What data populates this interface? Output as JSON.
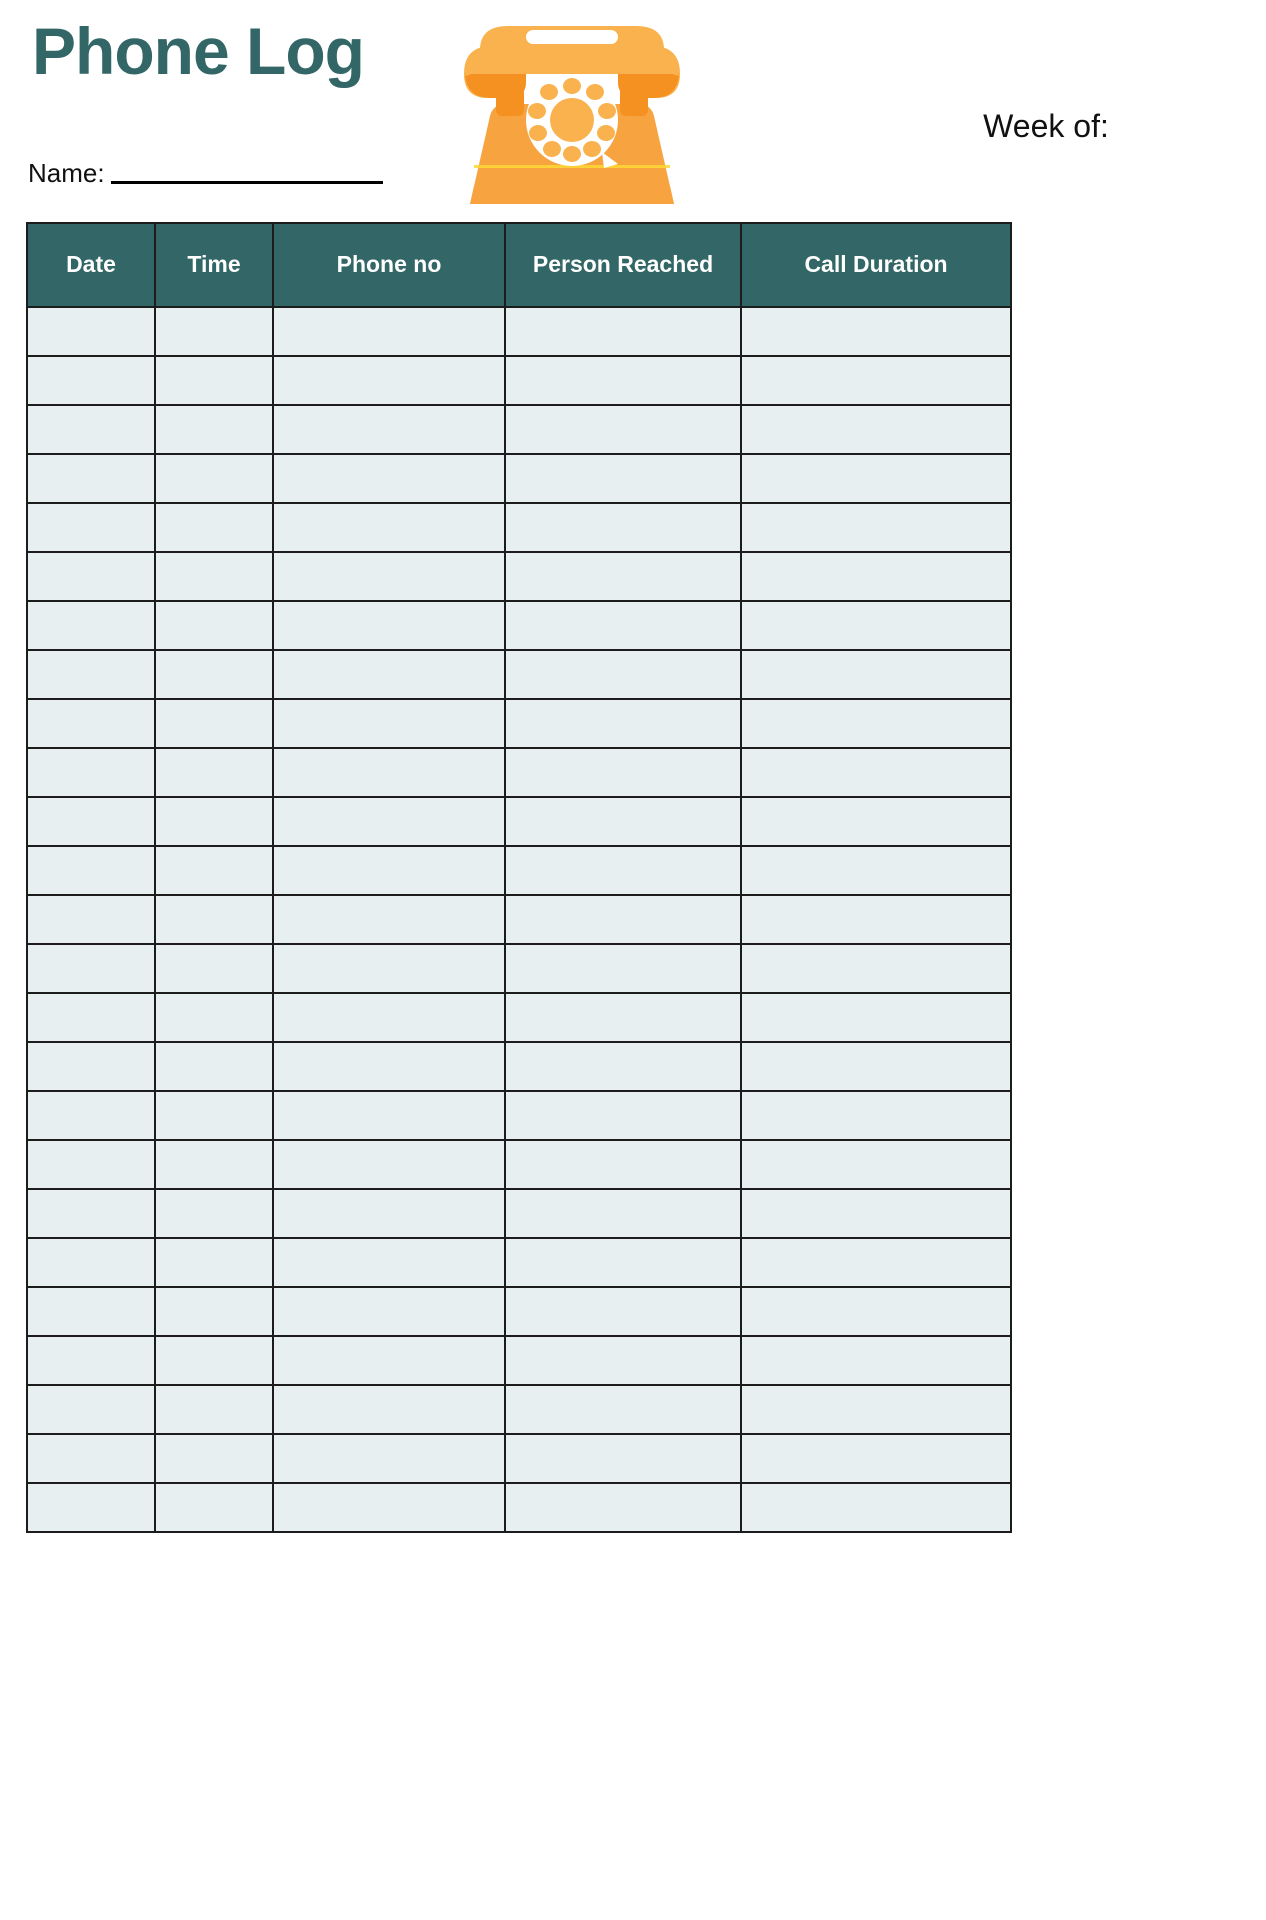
{
  "document": {
    "title": "Phone Log",
    "accent_color": "#336666",
    "illustration_color": "#f7a440",
    "cell_fill": "#e8eff1"
  },
  "fields": {
    "name_label": "Name:",
    "name_value": "",
    "week_of_label": "Week of:",
    "week_of_value": ""
  },
  "illustration": {
    "name": "rotary-telephone-icon"
  },
  "table": {
    "columns": [
      {
        "label": "Date",
        "key": "date"
      },
      {
        "label": "Time",
        "key": "time"
      },
      {
        "label": "Phone no",
        "key": "phone_no"
      },
      {
        "label": "Person Reached",
        "key": "person_reached"
      },
      {
        "label": "Call Duration",
        "key": "call_duration"
      }
    ],
    "row_count": 25,
    "rows": [
      {
        "date": "",
        "time": "",
        "phone_no": "",
        "person_reached": "",
        "call_duration": ""
      },
      {
        "date": "",
        "time": "",
        "phone_no": "",
        "person_reached": "",
        "call_duration": ""
      },
      {
        "date": "",
        "time": "",
        "phone_no": "",
        "person_reached": "",
        "call_duration": ""
      },
      {
        "date": "",
        "time": "",
        "phone_no": "",
        "person_reached": "",
        "call_duration": ""
      },
      {
        "date": "",
        "time": "",
        "phone_no": "",
        "person_reached": "",
        "call_duration": ""
      },
      {
        "date": "",
        "time": "",
        "phone_no": "",
        "person_reached": "",
        "call_duration": ""
      },
      {
        "date": "",
        "time": "",
        "phone_no": "",
        "person_reached": "",
        "call_duration": ""
      },
      {
        "date": "",
        "time": "",
        "phone_no": "",
        "person_reached": "",
        "call_duration": ""
      },
      {
        "date": "",
        "time": "",
        "phone_no": "",
        "person_reached": "",
        "call_duration": ""
      },
      {
        "date": "",
        "time": "",
        "phone_no": "",
        "person_reached": "",
        "call_duration": ""
      },
      {
        "date": "",
        "time": "",
        "phone_no": "",
        "person_reached": "",
        "call_duration": ""
      },
      {
        "date": "",
        "time": "",
        "phone_no": "",
        "person_reached": "",
        "call_duration": ""
      },
      {
        "date": "",
        "time": "",
        "phone_no": "",
        "person_reached": "",
        "call_duration": ""
      },
      {
        "date": "",
        "time": "",
        "phone_no": "",
        "person_reached": "",
        "call_duration": ""
      },
      {
        "date": "",
        "time": "",
        "phone_no": "",
        "person_reached": "",
        "call_duration": ""
      },
      {
        "date": "",
        "time": "",
        "phone_no": "",
        "person_reached": "",
        "call_duration": ""
      },
      {
        "date": "",
        "time": "",
        "phone_no": "",
        "person_reached": "",
        "call_duration": ""
      },
      {
        "date": "",
        "time": "",
        "phone_no": "",
        "person_reached": "",
        "call_duration": ""
      },
      {
        "date": "",
        "time": "",
        "phone_no": "",
        "person_reached": "",
        "call_duration": ""
      },
      {
        "date": "",
        "time": "",
        "phone_no": "",
        "person_reached": "",
        "call_duration": ""
      },
      {
        "date": "",
        "time": "",
        "phone_no": "",
        "person_reached": "",
        "call_duration": ""
      },
      {
        "date": "",
        "time": "",
        "phone_no": "",
        "person_reached": "",
        "call_duration": ""
      },
      {
        "date": "",
        "time": "",
        "phone_no": "",
        "person_reached": "",
        "call_duration": ""
      },
      {
        "date": "",
        "time": "",
        "phone_no": "",
        "person_reached": "",
        "call_duration": ""
      },
      {
        "date": "",
        "time": "",
        "phone_no": "",
        "person_reached": "",
        "call_duration": ""
      }
    ]
  }
}
